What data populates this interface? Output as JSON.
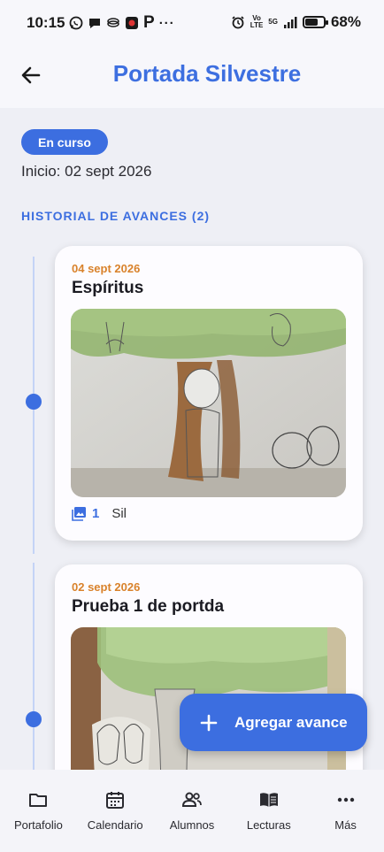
{
  "status_bar": {
    "time": "10:15",
    "p_icon": "P",
    "more": "···",
    "network_top": "Vo",
    "network_bottom": "LTE",
    "network_5g": "5G",
    "battery": "68%",
    "battery_level": 0.68
  },
  "header": {
    "title": "Portada Silvestre",
    "back_icon": "arrow-left-icon"
  },
  "status_chip": "En curso",
  "start_date": "Inicio: 02 sept 2026",
  "section_title": "HISTORIAL DE AVANCES (2)",
  "entries": [
    {
      "date": "04 sept 2026",
      "title": "Espíritus",
      "photo_count": "1",
      "author": "Sil",
      "photo_icon": "image-icon"
    },
    {
      "date": "02 sept 2026",
      "title": "Prueba 1 de portda"
    }
  ],
  "fab": {
    "label": "Agregar avance",
    "icon": "plus-icon"
  },
  "bottom_nav": [
    {
      "label": "Portafolio",
      "icon": "folder-icon"
    },
    {
      "label": "Calendario",
      "icon": "calendar-icon"
    },
    {
      "label": "Alumnos",
      "icon": "students-icon"
    },
    {
      "label": "Lecturas",
      "icon": "book-icon"
    },
    {
      "label": "Más",
      "icon": "more-icon"
    }
  ],
  "colors": {
    "accent": "#3c6ee0",
    "date_orange": "#d9822b",
    "background": "#eeeff5"
  }
}
